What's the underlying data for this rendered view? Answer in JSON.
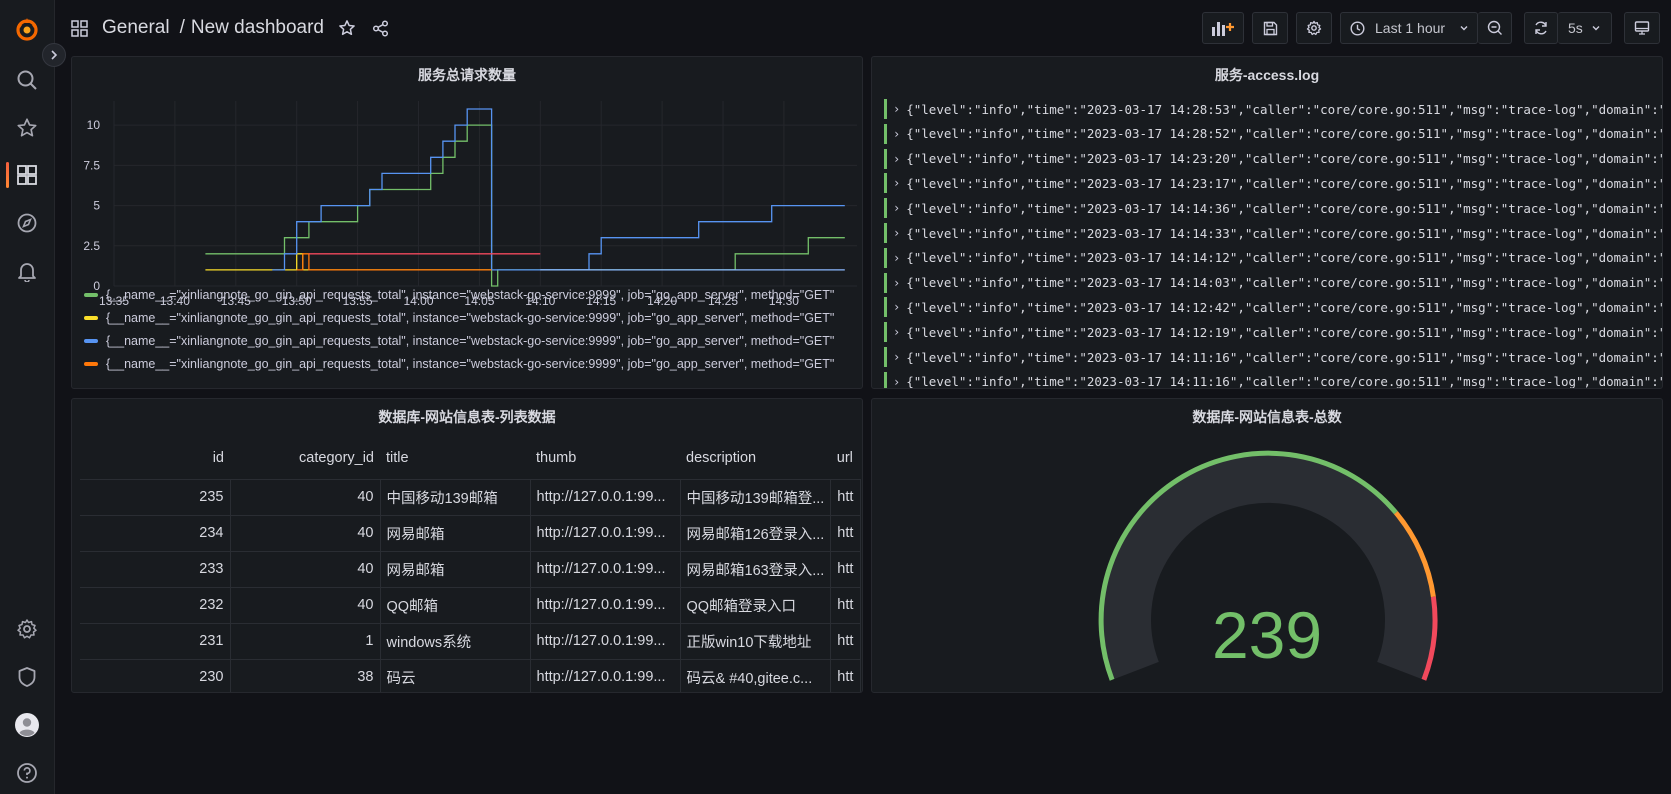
{
  "breadcrumb": {
    "folder": "General",
    "separator": "/",
    "dashboard": "New dashboard"
  },
  "toolbar": {
    "time_range": "Last 1 hour",
    "refresh_interval": "5s"
  },
  "colors": {
    "green": "#73bf69",
    "yellow": "#fade2a",
    "blue": "#5794f2",
    "orange": "#ff780a",
    "red": "#f2495c",
    "orange_gauge": "#ff9830"
  },
  "chart_panel": {
    "title": "服务总请求数量",
    "legend": [
      {
        "label": "{__name__=\"xinliangnote_go_gin_api_requests_total\", instance=\"webstack-go-service:9999\", job=\"go_app_server\", method=\"GET\"",
        "color": "#73bf69"
      },
      {
        "label": "{__name__=\"xinliangnote_go_gin_api_requests_total\", instance=\"webstack-go-service:9999\", job=\"go_app_server\", method=\"GET\"",
        "color": "#fade2a"
      },
      {
        "label": "{__name__=\"xinliangnote_go_gin_api_requests_total\", instance=\"webstack-go-service:9999\", job=\"go_app_server\", method=\"GET\"",
        "color": "#5794f2"
      },
      {
        "label": "{__name__=\"xinliangnote_go_gin_api_requests_total\", instance=\"webstack-go-service:9999\", job=\"go_app_server\", method=\"GET\"",
        "color": "#ff780a"
      }
    ]
  },
  "chart_data": {
    "type": "line",
    "x_ticks": [
      "13:35",
      "13:40",
      "13:45",
      "13:50",
      "13:55",
      "14:00",
      "14:05",
      "14:10",
      "14:15",
      "14:20",
      "14:25",
      "14:30"
    ],
    "y_ticks": [
      "0",
      "2.5",
      "5",
      "7.5",
      "10"
    ],
    "xlim": [
      "13:35",
      "14:36"
    ],
    "ylim": [
      0,
      11.5
    ],
    "grid": true,
    "legend_position": "bottom",
    "series": [
      {
        "color": "#73bf69",
        "points": [
          [
            "13:42:30",
            2
          ],
          [
            "13:49",
            2
          ],
          [
            "13:49",
            3
          ],
          [
            "13:51",
            3
          ],
          [
            "13:51",
            4
          ],
          [
            "13:55",
            4
          ],
          [
            "13:55",
            5
          ],
          [
            "13:56",
            5
          ],
          [
            "13:56",
            6
          ],
          [
            "14:01",
            6
          ],
          [
            "14:01",
            7
          ],
          [
            "14:02",
            7
          ],
          [
            "14:02",
            8
          ],
          [
            "14:03",
            8
          ],
          [
            "14:03",
            9
          ],
          [
            "14:04",
            9
          ],
          [
            "14:04",
            10
          ],
          [
            "14:06",
            10
          ],
          [
            "14:06",
            0
          ],
          [
            "14:06:30",
            0
          ],
          [
            "14:06:30",
            1
          ],
          [
            "14:26",
            1
          ],
          [
            "14:26",
            2
          ],
          [
            "14:32",
            2
          ],
          [
            "14:32",
            3
          ],
          [
            "14:35",
            3
          ]
        ]
      },
      {
        "color": "#fade2a",
        "points": [
          [
            "13:42:30",
            1
          ],
          [
            "13:50",
            1
          ],
          [
            "13:50",
            2
          ],
          [
            "13:50:30",
            2
          ],
          [
            "13:50:30",
            1
          ],
          [
            "14:06",
            1
          ]
        ]
      },
      {
        "color": "#5794f2",
        "points": [
          [
            "13:48",
            1
          ],
          [
            "13:49",
            1
          ],
          [
            "13:49",
            2
          ],
          [
            "13:50",
            2
          ],
          [
            "13:50",
            4
          ],
          [
            "13:52",
            4
          ],
          [
            "13:52",
            5
          ],
          [
            "13:56",
            5
          ],
          [
            "13:56",
            6
          ],
          [
            "13:57",
            6
          ],
          [
            "13:57",
            7
          ],
          [
            "14:01",
            7
          ],
          [
            "14:01",
            8
          ],
          [
            "14:02",
            8
          ],
          [
            "14:02",
            9
          ],
          [
            "14:03",
            9
          ],
          [
            "14:03",
            10
          ],
          [
            "14:04",
            10
          ],
          [
            "14:04",
            11
          ],
          [
            "14:06",
            11
          ],
          [
            "14:06",
            1
          ],
          [
            "14:14",
            1
          ],
          [
            "14:14",
            2
          ],
          [
            "14:15",
            2
          ],
          [
            "14:15",
            3
          ],
          [
            "14:23",
            3
          ],
          [
            "14:23",
            4
          ],
          [
            "14:29",
            4
          ],
          [
            "14:29",
            5
          ],
          [
            "14:35",
            5
          ]
        ]
      },
      {
        "color": "#ff780a",
        "points": [
          [
            "13:50",
            1
          ],
          [
            "13:50:30",
            1
          ],
          [
            "13:50:30",
            2
          ],
          [
            "13:51",
            2
          ],
          [
            "13:51",
            1
          ],
          [
            "14:06",
            1
          ]
        ]
      },
      {
        "color": "#f2495c",
        "points": [
          [
            "13:51",
            2
          ],
          [
            "14:10",
            2
          ]
        ]
      },
      {
        "color": "#8ab8ff",
        "points": [
          [
            "14:10",
            1
          ],
          [
            "14:35",
            1
          ]
        ]
      }
    ]
  },
  "log_panel": {
    "title": "服务-access.log",
    "lines": [
      "{\"level\":\"info\",\"time\":\"2023-03-17 14:28:53\",\"caller\":\"core/core.go:511\",\"msg\":\"trace-log\",\"domain\":\"g",
      "{\"level\":\"info\",\"time\":\"2023-03-17 14:28:52\",\"caller\":\"core/core.go:511\",\"msg\":\"trace-log\",\"domain\":\"g",
      "{\"level\":\"info\",\"time\":\"2023-03-17 14:23:20\",\"caller\":\"core/core.go:511\",\"msg\":\"trace-log\",\"domain\":\"g",
      "{\"level\":\"info\",\"time\":\"2023-03-17 14:23:17\",\"caller\":\"core/core.go:511\",\"msg\":\"trace-log\",\"domain\":\"g",
      "{\"level\":\"info\",\"time\":\"2023-03-17 14:14:36\",\"caller\":\"core/core.go:511\",\"msg\":\"trace-log\",\"domain\":\"g",
      "{\"level\":\"info\",\"time\":\"2023-03-17 14:14:33\",\"caller\":\"core/core.go:511\",\"msg\":\"trace-log\",\"domain\":\"g",
      "{\"level\":\"info\",\"time\":\"2023-03-17 14:14:12\",\"caller\":\"core/core.go:511\",\"msg\":\"trace-log\",\"domain\":\"g",
      "{\"level\":\"info\",\"time\":\"2023-03-17 14:14:03\",\"caller\":\"core/core.go:511\",\"msg\":\"trace-log\",\"domain\":\"g",
      "{\"level\":\"info\",\"time\":\"2023-03-17 14:12:42\",\"caller\":\"core/core.go:511\",\"msg\":\"trace-log\",\"domain\":\"g",
      "{\"level\":\"info\",\"time\":\"2023-03-17 14:12:19\",\"caller\":\"core/core.go:511\",\"msg\":\"trace-log\",\"domain\":\"g",
      "{\"level\":\"info\",\"time\":\"2023-03-17 14:11:16\",\"caller\":\"core/core.go:511\",\"msg\":\"trace-log\",\"domain\":\"g",
      "{\"level\":\"info\",\"time\":\"2023-03-17 14:11:16\",\"caller\":\"core/core.go:511\",\"msg\":\"trace-log\",\"domain\":\"g"
    ]
  },
  "table_panel": {
    "title": "数据库-网站信息表-列表数据",
    "columns": [
      "id",
      "category_id",
      "title",
      "thumb",
      "description",
      "url"
    ],
    "rows": [
      [
        "235",
        "40",
        "中国移动139邮箱",
        "http://127.0.0.1:99...",
        "中国移动139邮箱登...",
        "htt"
      ],
      [
        "234",
        "40",
        "网易邮箱",
        "http://127.0.0.1:99...",
        "网易邮箱126登录入...",
        "htt"
      ],
      [
        "233",
        "40",
        "网易邮箱",
        "http://127.0.0.1:99...",
        "网易邮箱163登录入...",
        "htt"
      ],
      [
        "232",
        "40",
        "QQ邮箱",
        "http://127.0.0.1:99...",
        "QQ邮箱登录入口",
        "htt"
      ],
      [
        "231",
        "1",
        "windows系统",
        "http://127.0.0.1:99...",
        "正版win10下载地址",
        "htt"
      ],
      [
        "230",
        "38",
        "码云",
        "http://127.0.0.1:99...",
        "码云& #40,gitee.c...",
        "htt"
      ]
    ]
  },
  "gauge_panel": {
    "title": "数据库-网站信息表-总数",
    "value": "239"
  }
}
